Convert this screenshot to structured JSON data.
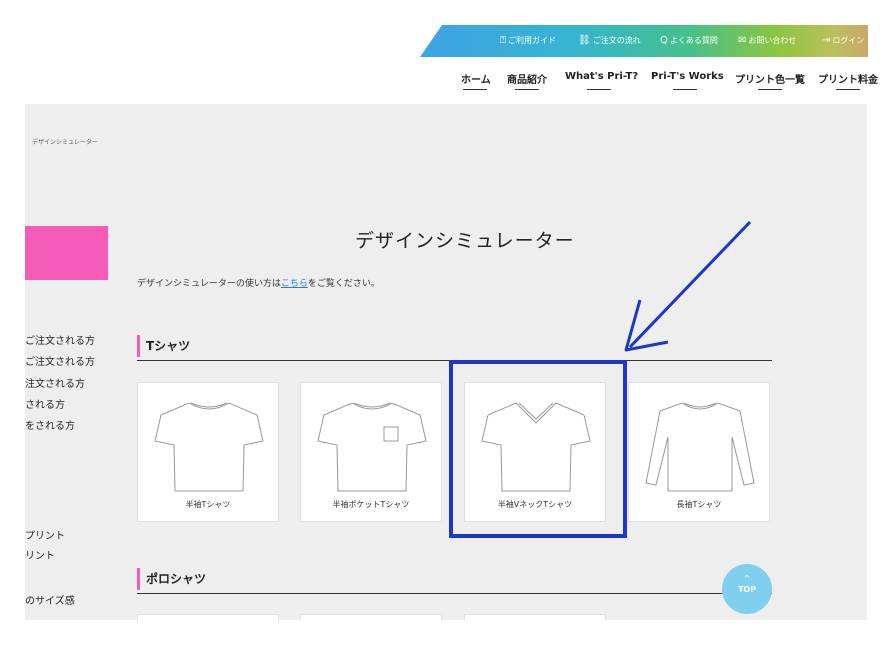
{
  "utility_nav": [
    {
      "icon": "guide-icon",
      "glyph": "⍰",
      "label": "ご利用ガイド"
    },
    {
      "icon": "flow-icon",
      "glyph": "⛓",
      "label": "ご注文の流れ"
    },
    {
      "icon": "faq-icon",
      "glyph": "Q",
      "label": "よくある質問"
    },
    {
      "icon": "mail-icon",
      "glyph": "✉",
      "label": "お問い合わせ"
    },
    {
      "icon": "login-icon",
      "glyph": "⇥",
      "label": "ログイン"
    }
  ],
  "main_nav": [
    "ホーム",
    "商品紹介",
    "What's Pri-T?",
    "Pri-T's Works",
    "プリント色一覧",
    "プリント料金"
  ],
  "breadcrumb": "デザインシミュレーター",
  "sidebar_links": [
    "ご注文される方",
    "ご注文される方",
    "注文される方",
    "される方",
    "をされる方",
    "プリント",
    "リント",
    "のサイズ感"
  ],
  "page_title": "デザインシミュレーター",
  "intro": {
    "before": "デザインシミュレーターの使い方は",
    "link": "こちら",
    "after": "をご覧ください。"
  },
  "sections": [
    {
      "title": "Tシャツ",
      "products": [
        {
          "label": "半袖Tシャツ",
          "icon": "tshirt-short-sleeve-icon"
        },
        {
          "label": "半袖ポケットTシャツ",
          "icon": "tshirt-pocket-icon"
        },
        {
          "label": "半袖VネックTシャツ",
          "icon": "tshirt-vneck-icon"
        },
        {
          "label": "長袖Tシャツ",
          "icon": "tshirt-long-sleeve-icon"
        }
      ]
    },
    {
      "title": "ポロシャツ"
    }
  ],
  "top_button": {
    "caret": "^",
    "label": "TOP"
  },
  "colors": {
    "accent_pink": "#f45cb8",
    "annotation_blue": "#1d37c9",
    "top_button": "#7fd0ef",
    "link": "#2a7bd3"
  }
}
